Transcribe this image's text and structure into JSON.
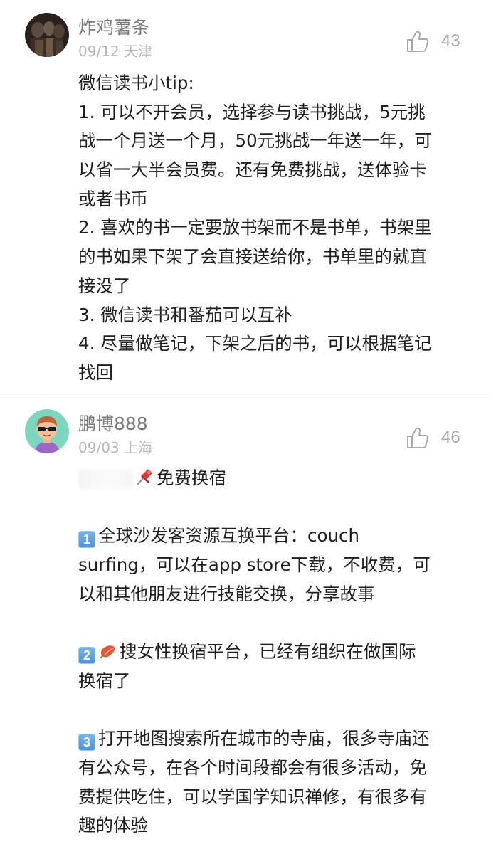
{
  "comments": [
    {
      "username": "炸鸡薯条",
      "meta": "09/12 天津",
      "likes": "43",
      "avatar": "dark-photo-avatar",
      "lines": [
        "微信读书小tip:",
        "1. 可以不开会员，选择参与读书挑战，5元挑",
        "战一个月送一个月，50元挑战一年送一年，可",
        "以省一大半会员费。还有免费挑战，送体验卡",
        "或者书币",
        "2. 喜欢的书一定要放书架而不是书单，书架里",
        "的书如果下架了会直接送给你，书单里的就直",
        "接没了",
        "3. 微信读书和番茄可以互补",
        "4. 尽量做笔记，下架之后的书，可以根据笔记",
        "找回"
      ]
    },
    {
      "username": "鹏博888",
      "meta": "09/03 上海",
      "likes": "46",
      "avatar": "cartoon-sunglasses-avatar",
      "heading": "免费换宿",
      "pin_icon": "pushpin-icon",
      "items": [
        {
          "number": "1",
          "lines": [
            "全球沙发客资源互换平台：couch",
            "surfing，可以在app store下载，不收费，可",
            "以和其他朋友进行技能交换，分享故事"
          ]
        },
        {
          "number": "2",
          "icon": "peach-icon",
          "lines": [
            "搜女性换宿平台，已经有组织在做国际",
            "换宿了"
          ]
        },
        {
          "number": "3",
          "lines": [
            "打开地图搜索所在城市的寺庙，很多寺庙还",
            "有公众号，在各个时间段都会有很多活动，免",
            "费提供吃住，可以学国学知识禅修，有很多有",
            "趣的体验"
          ]
        }
      ]
    }
  ],
  "colors": {
    "username": "#7a7a7a",
    "meta": "#b5b5b5",
    "body": "#1f1f1f",
    "like": "#a8a8a8",
    "divider": "#ececec",
    "keycap": "#5a9bd8"
  }
}
